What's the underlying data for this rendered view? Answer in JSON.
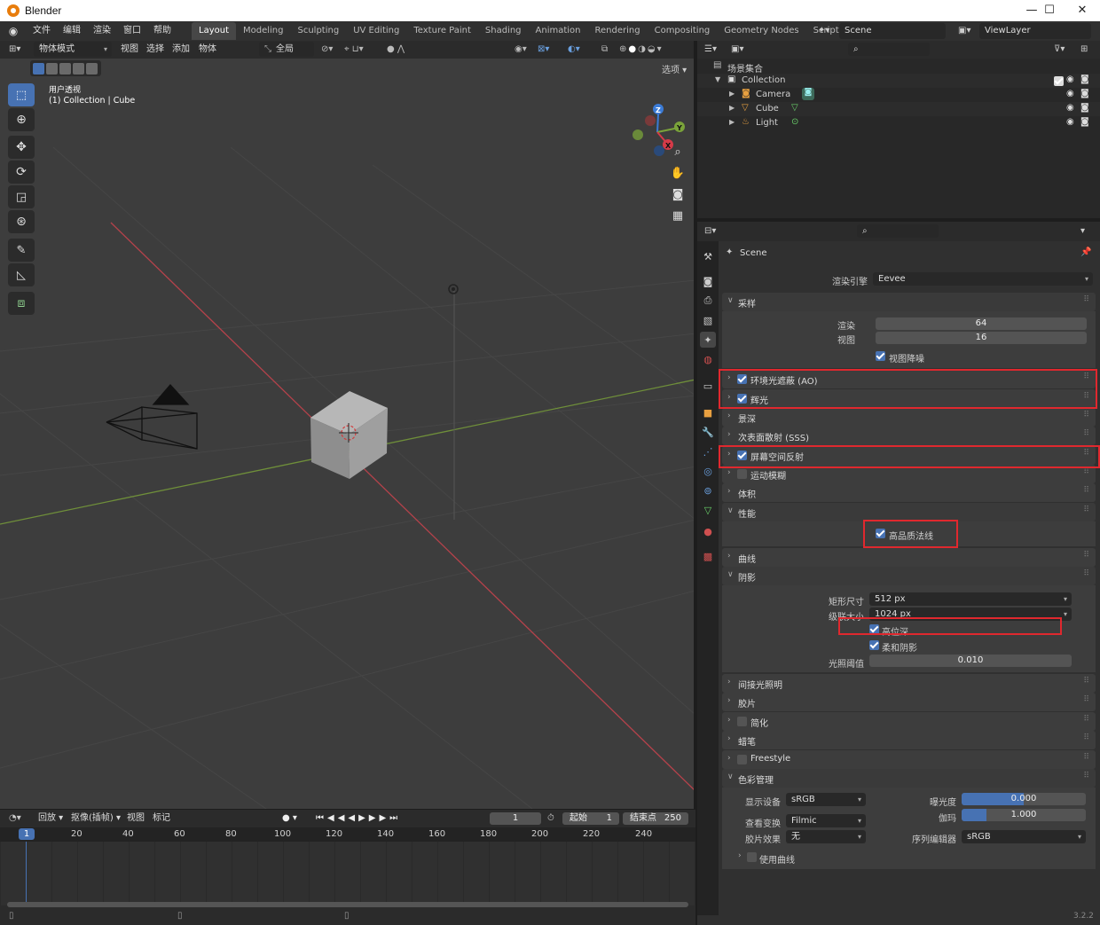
{
  "titlebar": {
    "title": "Blender",
    "minimize": "—",
    "maximize": "☐",
    "close": "✕"
  },
  "menu": [
    "文件",
    "编辑",
    "渲染",
    "窗口",
    "帮助"
  ],
  "workspaces": [
    "Layout",
    "Modeling",
    "Sculpting",
    "UV Editing",
    "Texture Paint",
    "Shading",
    "Animation",
    "Rendering",
    "Compositing",
    "Geometry Nodes",
    "Scripting"
  ],
  "workspace_add": "+",
  "scene": {
    "label": "Scene",
    "viewlayer": "ViewLayer"
  },
  "viewport": {
    "mode": "物体模式",
    "menu": [
      "视图",
      "选择",
      "添加",
      "物体"
    ],
    "transform_orientation": "全局",
    "options_label": "选项",
    "overlay_title": "用户透视",
    "overlay_subtitle": "(1) Collection | Cube",
    "gizmo": {
      "z": "Z",
      "y": "Y",
      "x": "X"
    }
  },
  "timeline": {
    "menu": [
      "回放",
      "抠像(插帧)",
      "视图",
      "标记"
    ],
    "current_frame": "1",
    "start_label": "起始",
    "start": "1",
    "end_label": "结束点",
    "end": "250",
    "ruler": [
      "1",
      "20",
      "40",
      "60",
      "80",
      "100",
      "120",
      "140",
      "160",
      "180",
      "200",
      "220",
      "240"
    ]
  },
  "outliner": {
    "root": "场景集合",
    "collection": "Collection",
    "items": [
      "Camera",
      "Cube",
      "Light"
    ]
  },
  "properties": {
    "context": "Scene",
    "render_engine_label": "渲染引擎",
    "render_engine": "Eevee",
    "sampling": {
      "title": "采样",
      "render_label": "渲染",
      "render": "64",
      "viewport_label": "视图",
      "viewport": "16",
      "denoise": "视图降噪"
    },
    "panels": {
      "ao": "环境光遮蔽 (AO)",
      "bloom": "辉光",
      "dof": "景深",
      "sss": "次表面散射 (SSS)",
      "ssr": "屏幕空间反射",
      "motion_blur": "运动模糊",
      "volumetrics": "体积",
      "performance": "性能",
      "high_quality_normals": "高品质法线",
      "curves": "曲线",
      "shadows": "阴影",
      "indirect": "间接光照明",
      "film": "胶片",
      "simplify": "简化",
      "grease_pencil": "蜡笔",
      "freestyle": "Freestyle",
      "color_mgmt": "色彩管理"
    },
    "shadows": {
      "cube_size_label": "矩形尺寸",
      "cube_size": "512 px",
      "cascade_label": "级联大小",
      "cascade": "1024 px",
      "high_bitdepth": "高位深",
      "soft_shadows": "柔和阴影",
      "light_threshold_label": "光照阈值",
      "light_threshold": "0.010"
    },
    "color": {
      "display_label": "显示设备",
      "display": "sRGB",
      "view_label": "查看变换",
      "view": "Filmic",
      "look_label": "胶片效果",
      "look": "无",
      "exposure_label": "曝光度",
      "exposure": "0.000",
      "gamma_label": "伽玛",
      "gamma": "1.000",
      "sequencer_label": "序列编辑器",
      "sequencer": "sRGB",
      "use_curves": "使用曲线"
    }
  },
  "version": "3.2.2",
  "colors": {
    "accent": "#4772b3",
    "highlight": "#e0282e",
    "x_axis": "#c8404a",
    "y_axis": "#7aa33a"
  }
}
